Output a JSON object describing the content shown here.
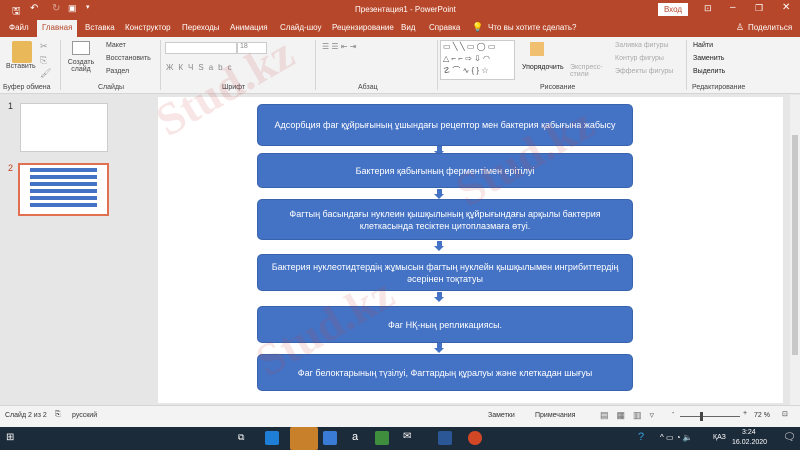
{
  "titlebar": {
    "title": "Презентация1 - PowerPoint",
    "signin": "Вход"
  },
  "tabs": [
    "Файл",
    "Главная",
    "Вставка",
    "Конструктор",
    "Переходы",
    "Анимация",
    "Слайд-шоу",
    "Рецензирование",
    "Вид",
    "Справка"
  ],
  "tell_me": "Что вы хотите сделать?",
  "share": "Поделиться",
  "ribbon": {
    "paste": "Вставить",
    "clipboard": "Буфер обмена",
    "new_slide": "Создать слайд",
    "layout": "Макет",
    "reset": "Восстановить",
    "section": "Раздел",
    "slides": "Слайды",
    "font_size": "18",
    "font": "Шрифт",
    "paragraph": "Абзац",
    "arrange": "Упорядочить",
    "quick_styles": "Экспресс-стили",
    "fill": "Заливка фигуры",
    "outline": "Контур фигуры",
    "effects": "Эффекты фигуры",
    "drawing": "Рисование",
    "find": "Найти",
    "replace": "Заменить",
    "select": "Выделить",
    "editing": "Редактирование"
  },
  "thumbnails": [
    {
      "num": "1"
    },
    {
      "num": "2"
    }
  ],
  "slide": {
    "steps": [
      "Адсорбция фаг құйрығының ұшындағы рецептор мен бактерия қабығына жабысу",
      "Бактерия қабығының ферментімен ерітілуі",
      "Фагтың басындағы нуклеин қышқылының құйрығындағы арқылы бактерия клеткасында тесіктен цитоплазмаға өтуі.",
      "Бактерия нуклеотидтердің жұмысын фагтың нуклейн қышқылымен ингрибиттердің әсерінен тоқтатуы",
      "Фаг НҚ-ның репликациясы.",
      "Фаг белоктарының түзілуі,  Фагтардың құралуы және клеткадан шығуы"
    ]
  },
  "status": {
    "slide": "Слайд 2 из 2",
    "lang": "русский",
    "notes": "Заметки",
    "comments": "Примечания",
    "zoom": "72 %",
    "zoom_value": 72
  },
  "taskbar": {
    "time": "3:24",
    "date": "16.02.2020",
    "lang": "ҚАЗ"
  }
}
